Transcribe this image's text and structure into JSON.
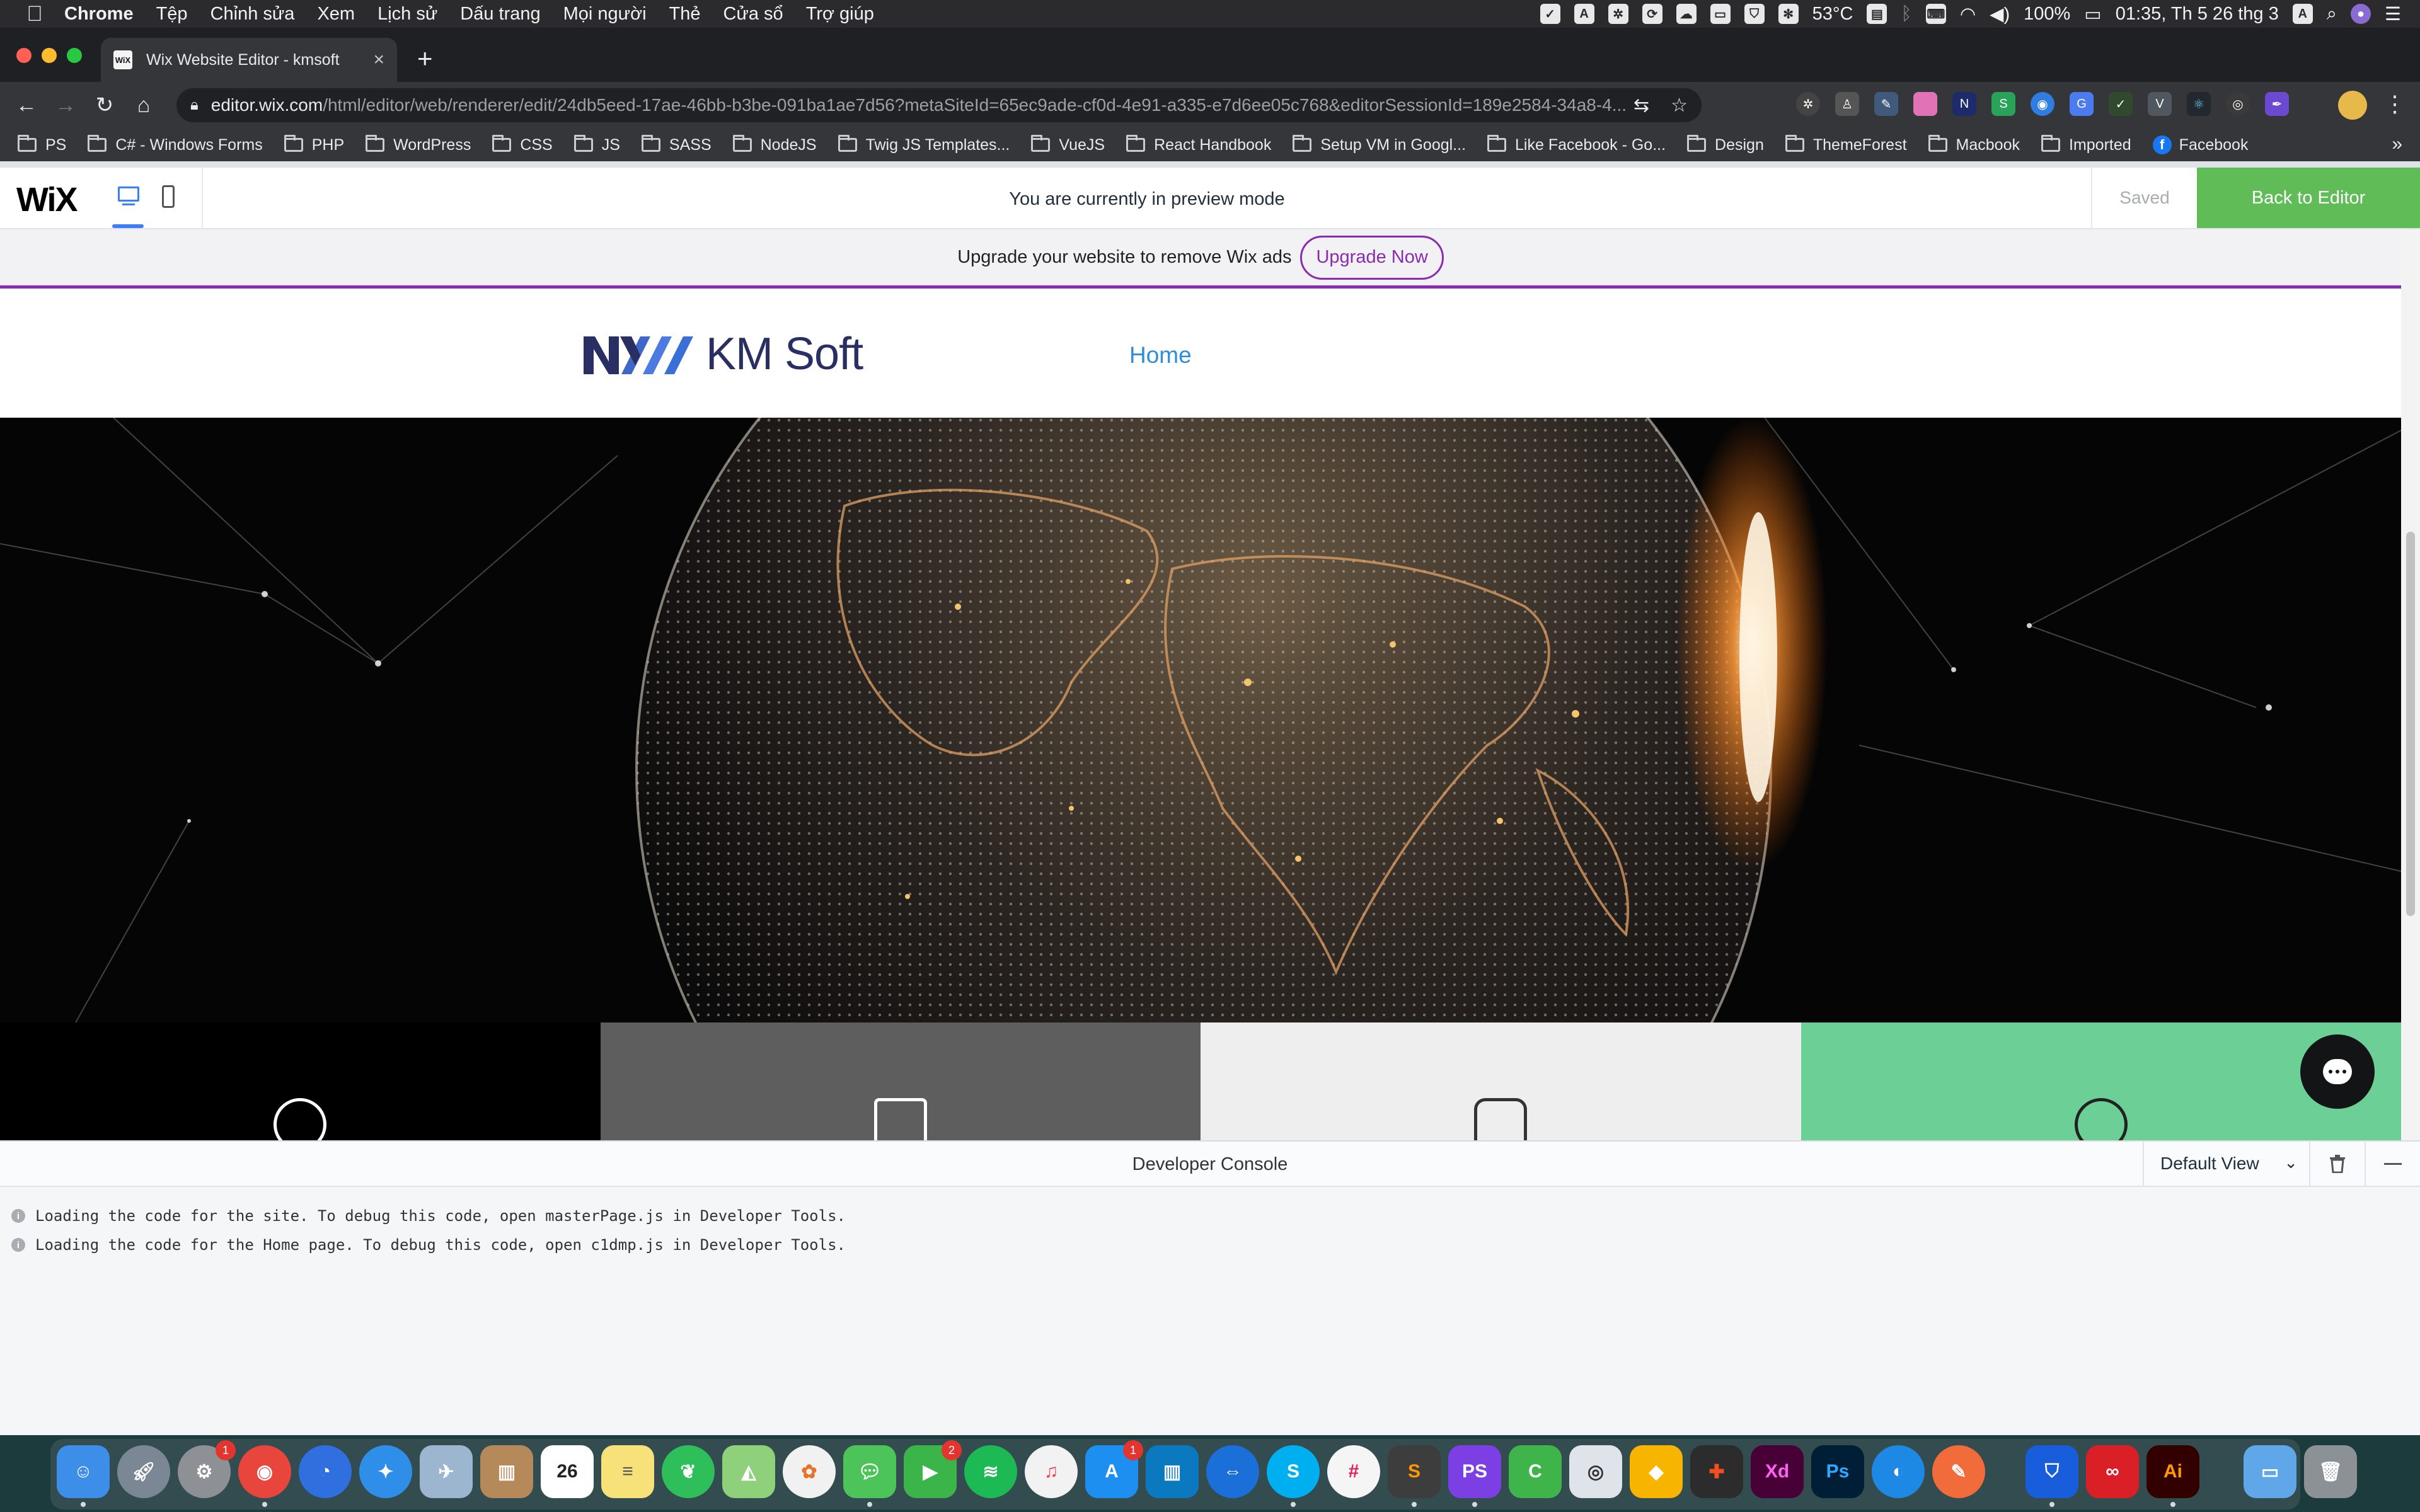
{
  "menubar": {
    "app": "Chrome",
    "items": [
      "Tệp",
      "Chỉnh sửa",
      "Xem",
      "Lịch sử",
      "Dấu trang",
      "Mọi người",
      "Thẻ",
      "Cửa sổ",
      "Trợ giúp"
    ],
    "temperature": "53°C",
    "battery": "100%",
    "clock": "01:35, Th 5 26 thg 3",
    "input_source": "A"
  },
  "browser": {
    "tab_title": "Wix Website Editor - kmsoft",
    "tab_favicon": "WiX",
    "url_host": "editor.wix.com",
    "url_path": "/html/editor/web/renderer/edit/24db5eed-17ae-46bb-b3be-091ba1ae7d56?metaSiteId=65ec9ade-cf0d-4e91-a335-e7d6ee05c768&editorSessionId=189e2584-34a8-4...",
    "bookmarks": [
      "PS",
      "C# - Windows Forms",
      "PHP",
      "WordPress",
      "CSS",
      "JS",
      "SASS",
      "NodeJS",
      "Twig JS Templates...",
      "VueJS",
      "React Handbook",
      "Setup VM in Googl...",
      "Like Facebook - Go...",
      "Design",
      "ThemeForest",
      "Macbook",
      "Imported",
      "Facebook"
    ],
    "bookmarks_more": "»"
  },
  "wix_bar": {
    "logo": "WiX",
    "preview_message": "You are currently in preview mode",
    "saved_label": "Saved",
    "back_button": "Back to Editor",
    "accent_color": "#60bc57"
  },
  "site": {
    "ad_text": "Upgrade your website to remove Wix ads",
    "upgrade_button": "Upgrade Now",
    "brand": "KM Soft",
    "nav_home": "Home",
    "brand_color": "#2a2f63",
    "nav_color": "#2f8fd6",
    "tile_colors": [
      "#000000",
      "#5e5e5f",
      "#eeeeee",
      "#6ccf96"
    ]
  },
  "console": {
    "title": "Developer Console",
    "view": "Default View",
    "logs": [
      "Loading the code for the site. To debug this code, open masterPage.js in Developer Tools.",
      "Loading the code for the Home page. To debug this code, open c1dmp.js in Developer Tools."
    ]
  },
  "dock": {
    "calendar_day": "26",
    "badges": {
      "system_preferences": "1",
      "facetime": "2",
      "app_store": "1"
    }
  }
}
